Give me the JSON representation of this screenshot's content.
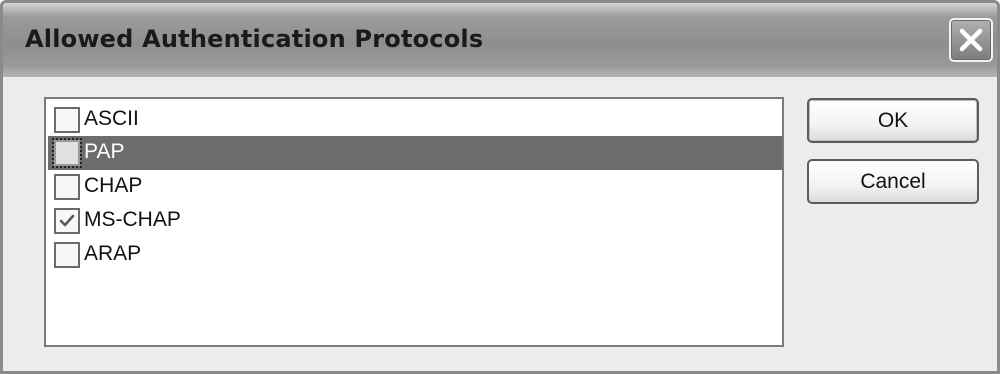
{
  "window": {
    "title": "Allowed Authentication Protocols",
    "close_icon": "close-icon"
  },
  "protocols": {
    "items": [
      {
        "label": "ASCII",
        "checked": false,
        "selected": false
      },
      {
        "label": "PAP",
        "checked": false,
        "selected": true
      },
      {
        "label": "CHAP",
        "checked": false,
        "selected": false
      },
      {
        "label": "MS-CHAP",
        "checked": true,
        "selected": false
      },
      {
        "label": "ARAP",
        "checked": false,
        "selected": false
      }
    ]
  },
  "buttons": {
    "ok_label": "OK",
    "cancel_label": "Cancel"
  },
  "colors": {
    "selection": "#6d6d6d",
    "titlebar": "#8e8e8e"
  }
}
